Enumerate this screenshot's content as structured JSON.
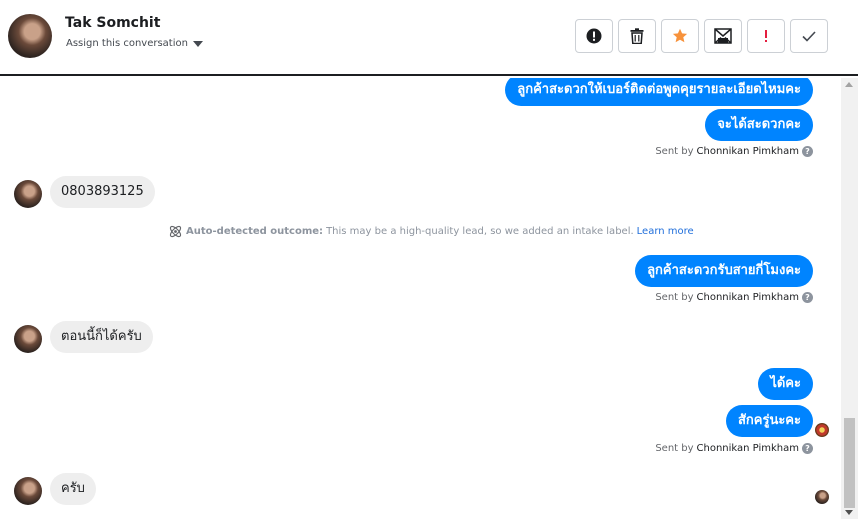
{
  "header": {
    "contact_name": "Tak Somchit",
    "assign_label": "Assign this conversation"
  },
  "toolbar": {
    "buttons": [
      {
        "name": "alert-icon"
      },
      {
        "name": "trash-icon"
      },
      {
        "name": "star-icon",
        "color": "#f7923b"
      },
      {
        "name": "mark-unread-icon"
      },
      {
        "name": "spam-icon",
        "color": "#e41e3f"
      },
      {
        "name": "checkmark-icon"
      }
    ]
  },
  "messages": {
    "out_1": "ลูกค้าสะดวกให้เบอร์ติดต่อพูดคุยรายละเอียดไหมคะ",
    "out_2": "จะได้สะดวกคะ",
    "sent_by_prefix": "Sent by",
    "agent_name": "Chonnikan Pimkham",
    "in_1": "0803893125",
    "outcome_label": "Auto-detected outcome:",
    "outcome_text": "This may be a high-quality lead, so we added an intake label.",
    "outcome_link": "Learn more",
    "out_3": "ลูกค้าสะดวกรับสายกี่โมงคะ",
    "in_2": "ตอนนี้ก็ได้ครับ",
    "out_4": "ได้คะ",
    "out_5": "สักครู่นะคะ",
    "in_3": "ครับ"
  },
  "colors": {
    "accent": "#0084ff",
    "incoming_bubble": "#eeeeee",
    "star": "#f7923b",
    "spam": "#e41e3f",
    "link": "#216fdb"
  }
}
